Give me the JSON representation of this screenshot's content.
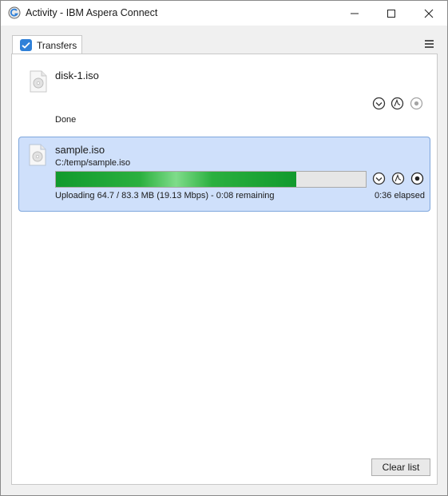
{
  "window": {
    "title": "Activity - IBM Aspera Connect",
    "icons": {
      "app": "aspera-app-icon",
      "minimize": "minimize-icon",
      "maximize": "maximize-icon",
      "close": "close-icon"
    }
  },
  "tabs": [
    {
      "label": "Transfers",
      "icon": "transfers-icon",
      "active": true
    }
  ],
  "menu_icon": "hamburger-menu-icon",
  "transfers": [
    {
      "name": "disk-1.iso",
      "status": "Done",
      "icon": "iso-file-icon",
      "controls": [
        "reveal-icon",
        "details-icon",
        "stop-icon"
      ]
    },
    {
      "name": "sample.iso",
      "path": "C:/temp/sample.iso",
      "progress": 0.777,
      "status": "Uploading 64.7 / 83.3 MB (19.13 Mbps) - 0:08 remaining",
      "elapsed": "0:36 elapsed",
      "icon": "iso-file-icon",
      "controls": [
        "reveal-icon",
        "details-icon",
        "stop-icon"
      ]
    }
  ],
  "footer": {
    "clear_label": "Clear list"
  },
  "colors": {
    "active_row": "#cfe0fb",
    "active_border": "#7ea6dc",
    "progress_green": "#119a2d",
    "tab_icon_blue": "#2f80d8"
  }
}
